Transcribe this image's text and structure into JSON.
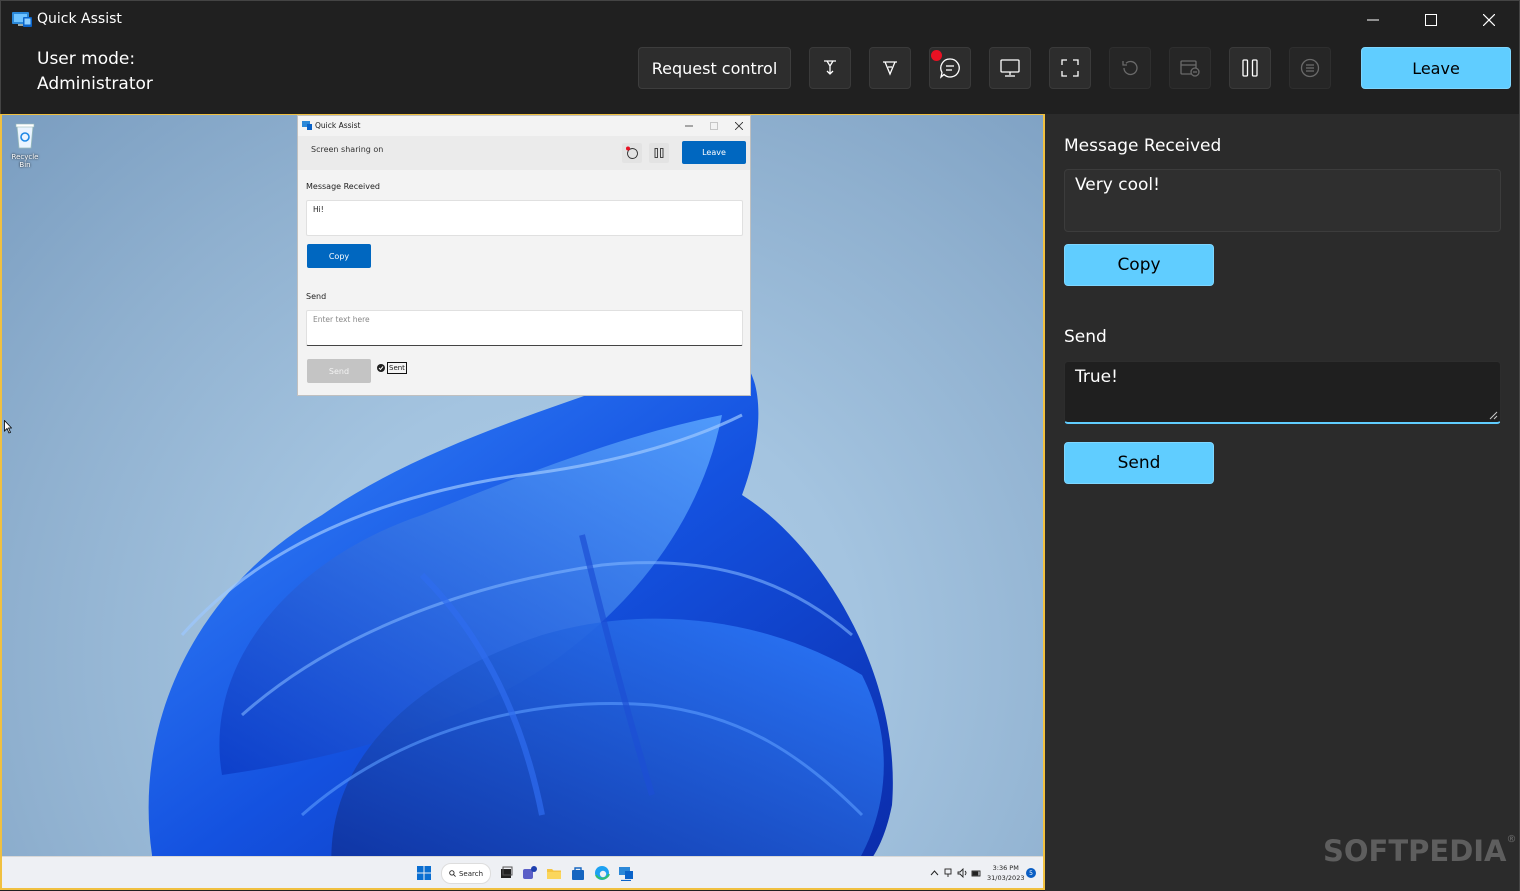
{
  "window": {
    "title": "Quick Assist",
    "minimize_icon": "minimize-icon",
    "maximize_icon": "maximize-icon",
    "close_icon": "close-icon"
  },
  "toolbar": {
    "mode_label": "User mode:",
    "mode_value": "Administrator",
    "request_control": "Request control",
    "tools": [
      "laser-pointer-icon",
      "annotate-icon",
      "chat-icon",
      "select-monitor-icon",
      "fullscreen-icon",
      "restart-icon",
      "task-manager-icon",
      "pause-icon",
      "details-icon"
    ],
    "leave": "Leave",
    "accent_color": "#60cdff"
  },
  "remote": {
    "desktop": {
      "recycle_bin_label": "Recycle Bin"
    },
    "inner_window": {
      "title": "Quick Assist",
      "status": "Screen sharing on",
      "leave": "Leave",
      "message_received_label": "Message Received",
      "message_received": "Hi!",
      "copy": "Copy",
      "send_label": "Send",
      "send_placeholder": "Enter text here",
      "send": "Send",
      "sent": "Sent"
    },
    "taskbar": {
      "search": "Search",
      "time": "3:36 PM",
      "date": "31/03/2023",
      "badge": "5"
    }
  },
  "panel": {
    "message_received_label": "Message Received",
    "message_received": "Very cool!",
    "copy": "Copy",
    "send_label": "Send",
    "send_value": "True!",
    "send": "Send"
  },
  "watermark": "SOFTPEDIA",
  "watermark_mark": "®"
}
